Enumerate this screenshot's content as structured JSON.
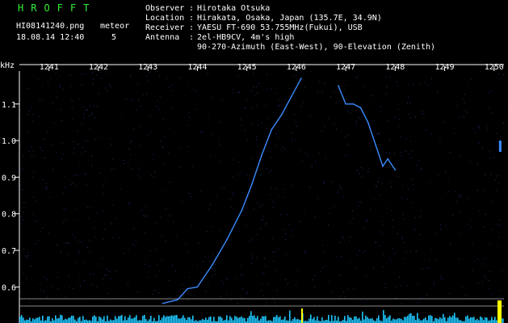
{
  "header": {
    "brand": "HROFFT",
    "filename": "HI08141240.png",
    "datetime": "18.08.14 12:40",
    "meteor_label": "meteor",
    "meteor_count": "5"
  },
  "info": {
    "observer_key": "Observer",
    "observer_val": "Hirotaka Otsuka",
    "location_key": "Location",
    "location_val": "Hirakata, Osaka, Japan (135.7E, 34.9N)",
    "receiver_key": "Receiver",
    "receiver_val": "YAESU FT-690 53.755MHz(Fukui), USB",
    "antenna_key": "Antenna",
    "antenna_val": "2el-HB9CV, 4m's high",
    "antenna_val2": "90-270-Azimuth (East-West), 90-Elevation (Zenith)"
  },
  "axis": {
    "unit": "kHz",
    "x_ticks": [
      "1241",
      "1242",
      "1243",
      "1244",
      "1245",
      "1246",
      "1247",
      "1248",
      "1249",
      "1250"
    ],
    "y_ticks": [
      "1.1",
      "1.0",
      "0.9",
      "0.8",
      "0.7",
      "0.6"
    ]
  },
  "chart_data": {
    "type": "line",
    "xlabel": "",
    "ylabel": "kHz",
    "xlim": [
      1240.4,
      1250.2
    ],
    "ylim": [
      0.55,
      1.19
    ],
    "x_tick_values": [
      1241,
      1242,
      1243,
      1244,
      1245,
      1246,
      1247,
      1248,
      1249,
      1250
    ],
    "y_tick_values": [
      1.1,
      1.0,
      0.9,
      0.8,
      0.7,
      0.6
    ],
    "series": [
      {
        "color": "#3a8cff",
        "x": [
          1243.3,
          1243.6,
          1243.8,
          1244.0,
          1244.3,
          1244.6,
          1244.9,
          1245.1,
          1245.3,
          1245.5,
          1245.7,
          1245.9,
          1246.1
        ],
        "y": [
          0.555,
          0.565,
          0.595,
          0.6,
          0.66,
          0.73,
          0.81,
          0.88,
          0.96,
          1.03,
          1.07,
          1.12,
          1.17
        ]
      },
      {
        "color": "#3a8cff",
        "x": [
          1246.85,
          1247.0,
          1247.15,
          1247.3,
          1247.45,
          1247.6,
          1247.75,
          1247.85,
          1248.0
        ],
        "y": [
          1.15,
          1.1,
          1.1,
          1.09,
          1.05,
          0.99,
          0.93,
          0.95,
          0.92
        ]
      }
    ]
  },
  "colors": {
    "accent": "#33ee33",
    "signal": "#3a8cff",
    "spectrum": "#1ec8ff",
    "marker": "#ffff00"
  }
}
